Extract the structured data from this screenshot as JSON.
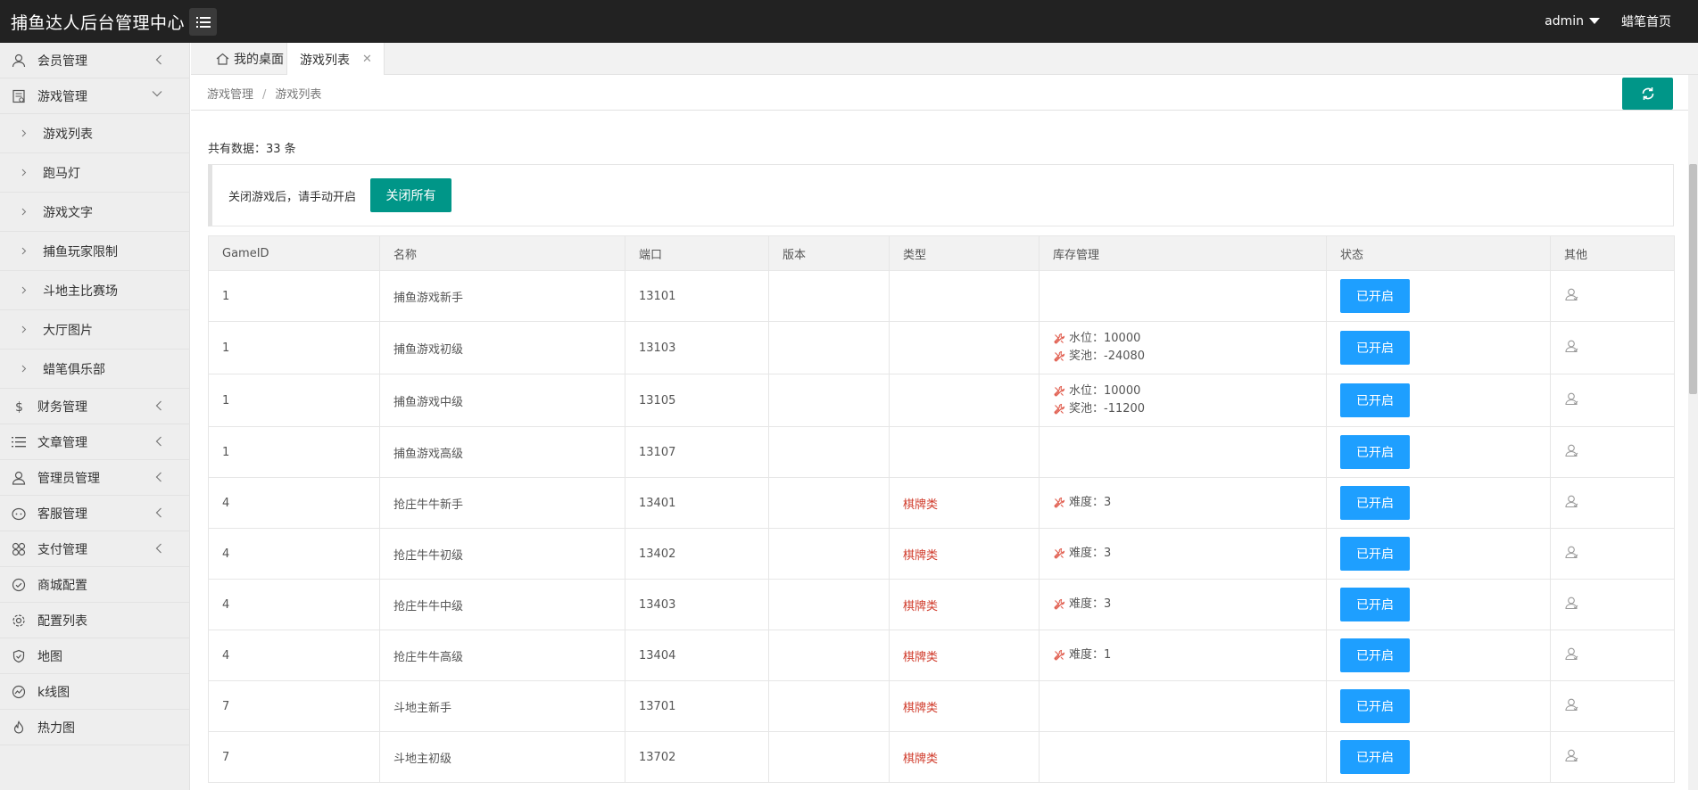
{
  "header": {
    "title": "捕鱼达人后台管理中心",
    "user": "admin",
    "home_link": "蜡笔首页"
  },
  "sidebar": {
    "items": [
      {
        "label": "会员管理",
        "icon": "user-icon",
        "expandable": true
      },
      {
        "label": "游戏管理",
        "icon": "game-doc-icon",
        "expandable": true,
        "expanded": true,
        "children": [
          "游戏列表",
          "跑马灯",
          "游戏文字",
          "捕鱼玩家限制",
          "斗地主比赛场",
          "大厅图片",
          "蜡笔俱乐部"
        ]
      },
      {
        "label": "财务管理",
        "icon": "dollar-icon",
        "expandable": true
      },
      {
        "label": "文章管理",
        "icon": "list-icon",
        "expandable": true
      },
      {
        "label": "管理员管理",
        "icon": "admin-user-icon",
        "expandable": true
      },
      {
        "label": "客服管理",
        "icon": "service-icon",
        "expandable": true
      },
      {
        "label": "支付管理",
        "icon": "grid-flower-icon",
        "expandable": true
      },
      {
        "label": "商城配置",
        "icon": "check-circle-icon",
        "expandable": false
      },
      {
        "label": "配置列表",
        "icon": "gear-icon",
        "expandable": false
      },
      {
        "label": "地图",
        "icon": "shield-icon",
        "expandable": false
      },
      {
        "label": "k线图",
        "icon": "chart-circle-icon",
        "expandable": false
      },
      {
        "label": "热力图",
        "icon": "fire-icon",
        "expandable": false
      }
    ]
  },
  "tabs": [
    {
      "label": "我的桌面",
      "icon": "home-icon"
    },
    {
      "label": "游戏列表",
      "closable": true,
      "close_glyph": "✕",
      "active": true
    }
  ],
  "breadcrumb": {
    "items": [
      "游戏管理",
      "游戏列表"
    ],
    "separator": "/"
  },
  "summary": {
    "total_label": "共有数据：33 条"
  },
  "notice": {
    "text": "关闭游戏后，请手动开启",
    "close_all_label": "关闭所有"
  },
  "table": {
    "columns": [
      "GameID",
      "名称",
      "端口",
      "版本",
      "类型",
      "库存管理",
      "状态",
      "其他"
    ],
    "rows": [
      {
        "game_id": "1",
        "name": "捕鱼游戏新手",
        "port": "13101",
        "version": "",
        "type": "",
        "stock": [],
        "status": "已开启"
      },
      {
        "game_id": "1",
        "name": "捕鱼游戏初级",
        "port": "13103",
        "version": "",
        "type": "",
        "stock": [
          "水位：10000",
          "奖池：-24080"
        ],
        "status": "已开启"
      },
      {
        "game_id": "1",
        "name": "捕鱼游戏中级",
        "port": "13105",
        "version": "",
        "type": "",
        "stock": [
          "水位：10000",
          "奖池：-11200"
        ],
        "status": "已开启"
      },
      {
        "game_id": "1",
        "name": "捕鱼游戏高级",
        "port": "13107",
        "version": "",
        "type": "",
        "stock": [],
        "status": "已开启"
      },
      {
        "game_id": "4",
        "name": "抢庄牛牛新手",
        "port": "13401",
        "version": "",
        "type": "棋牌类",
        "stock": [
          "难度：3"
        ],
        "status": "已开启"
      },
      {
        "game_id": "4",
        "name": "抢庄牛牛初级",
        "port": "13402",
        "version": "",
        "type": "棋牌类",
        "stock": [
          "难度：3"
        ],
        "status": "已开启"
      },
      {
        "game_id": "4",
        "name": "抢庄牛牛中级",
        "port": "13403",
        "version": "",
        "type": "棋牌类",
        "stock": [
          "难度：3"
        ],
        "status": "已开启"
      },
      {
        "game_id": "4",
        "name": "抢庄牛牛高级",
        "port": "13404",
        "version": "",
        "type": "棋牌类",
        "stock": [
          "难度：1"
        ],
        "status": "已开启"
      },
      {
        "game_id": "7",
        "name": "斗地主新手",
        "port": "13701",
        "version": "",
        "type": "棋牌类",
        "stock": [],
        "status": "已开启"
      },
      {
        "game_id": "7",
        "name": "斗地主初级",
        "port": "13702",
        "version": "",
        "type": "棋牌类",
        "stock": [],
        "status": "已开启"
      }
    ]
  },
  "colors": {
    "header_bg": "#222222",
    "accent_teal": "#009688",
    "status_blue": "#1e9fff",
    "category_red": "#d03b2b",
    "wrench_red": "#e05a4b"
  }
}
